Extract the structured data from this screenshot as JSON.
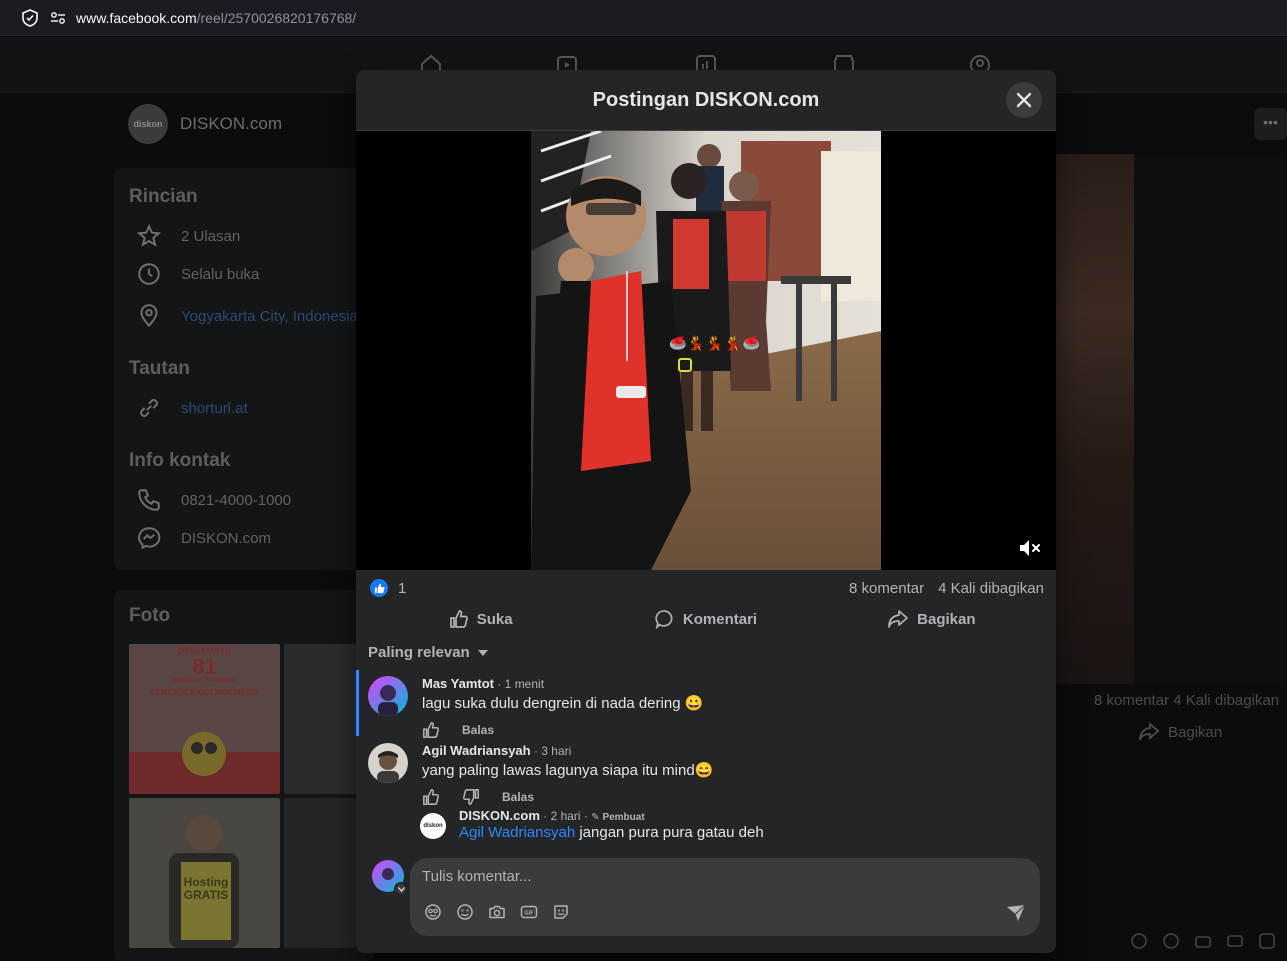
{
  "browser": {
    "url_host": "www.facebook.com",
    "url_path": "/reel/2570026820176768/"
  },
  "background": {
    "page_name": "DISKON.com",
    "avatar_text": "diskon",
    "sections": {
      "rincian": "Rincian",
      "tautan": "Tautan",
      "info_kontak": "Info kontak",
      "foto": "Foto"
    },
    "rows": {
      "ulasan": "2 Ulasan",
      "jam": "Selalu buka",
      "lokasi": "Yogyakarta City, Indonesia",
      "link": "shorturl.at",
      "telepon": "0821-4000-1000",
      "messenger": "DISKON.com"
    },
    "right_stats": "8 komentar   4 Kali dibagikan",
    "right_share": "Bagikan",
    "photo1_lines": [
      "DIRGAHAYU",
      "81",
      "REPUBLIK INDONESIA",
      "KEMERDEKAAN INDONESIA"
    ],
    "photo3_lines": [
      "Hosting",
      "GRATIS"
    ]
  },
  "modal": {
    "title": "Postingan DISKON.com",
    "likes": "1",
    "comments_count": "8 komentar",
    "shares_count": "4 Kali dibagikan",
    "actions": {
      "like": "Suka",
      "comment": "Komentari",
      "share": "Bagikan"
    },
    "sort_label": "Paling relevan",
    "comments": [
      {
        "author": "Mas Yamtot",
        "time": " · 1 menit",
        "text": "lagu suka dulu dengrein di nada dering 😀",
        "reply_label": "Balas"
      },
      {
        "author": "Agil Wadriansyah",
        "time": " · 3 hari",
        "text": "yang paling lawas lagunya siapa itu mind😄",
        "reply_label": "Balas"
      }
    ],
    "reply": {
      "author": "DISKON.com",
      "time": " · 2 hari · ",
      "badge": "Pembuat",
      "mention": "Agil Wadriansyah",
      "text": " jangan pura pura gatau deh",
      "avatar_text": "diskon"
    },
    "composer": {
      "placeholder": "Tulis komentar..."
    },
    "video_emoji": "🥌💃💃💃🥌"
  },
  "colors": {
    "accent": "#2d88ff",
    "like": "#1877f2",
    "modal_bg": "#242526",
    "input_bg": "#3a3b3c"
  },
  "icons": [
    "shield-icon",
    "site-info-icon",
    "close-icon",
    "mute-icon",
    "like-icon",
    "comment-icon",
    "share-icon",
    "caret-down-icon",
    "avatar-sticker-icon",
    "emoji-icon",
    "camera-icon",
    "gif-icon",
    "sticker-icon",
    "send-icon"
  ]
}
